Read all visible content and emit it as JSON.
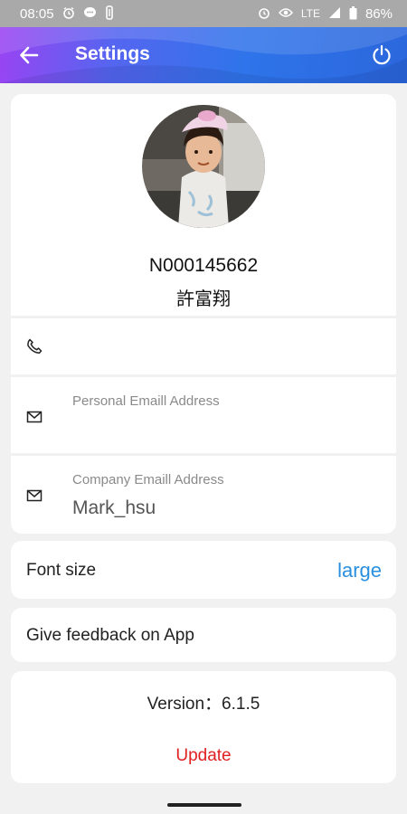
{
  "status_bar": {
    "time": "08:05",
    "network": "LTE",
    "battery": "86%",
    "icons_left": [
      "alarm-icon",
      "message-icon",
      "usb-icon"
    ],
    "icons_right": [
      "alarm-icon",
      "eye-icon",
      "signal-icon",
      "battery-icon"
    ]
  },
  "app_bar": {
    "title": "Settings",
    "back_icon": "arrow-back-icon",
    "power_icon": "power-icon",
    "gradient": [
      "#9b43f2",
      "#2f74ea",
      "#2b66dc"
    ]
  },
  "profile": {
    "id": "N000145662",
    "name": "許富翔",
    "avatar": "child-photo"
  },
  "fields": {
    "phone": {
      "icon": "phone-icon",
      "value": ""
    },
    "personal_email": {
      "icon": "mail-icon",
      "label": "Personal Emaill Address",
      "value": ""
    },
    "company_email": {
      "icon": "mail-icon",
      "label": "Company Emaill Address",
      "value": "Mark_hsu"
    }
  },
  "font_size": {
    "label": "Font size",
    "value": "large"
  },
  "feedback": {
    "label": "Give feedback on App"
  },
  "version": {
    "text": "Version：6.1.5",
    "update_label": "Update"
  },
  "colors": {
    "accent_blue": "#2a8fde",
    "update_red": "#e02020",
    "background": "#f1f1f1"
  }
}
